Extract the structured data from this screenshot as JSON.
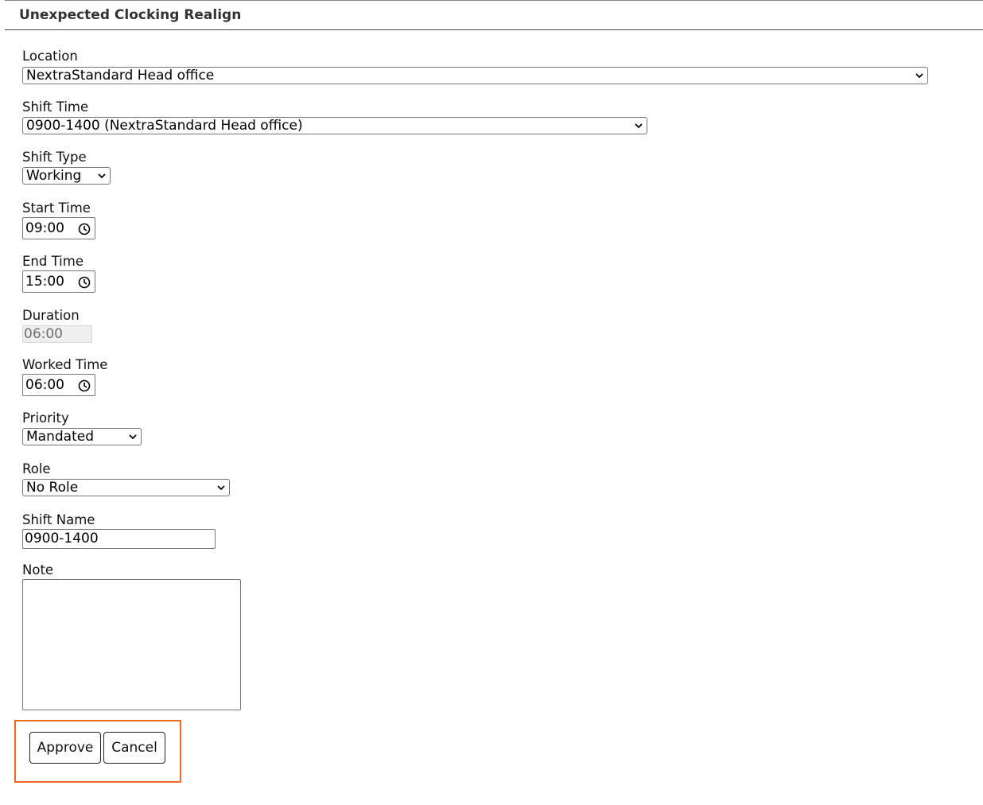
{
  "dialog": {
    "title": "Unexpected Clocking Realign"
  },
  "form": {
    "location": {
      "label": "Location",
      "value": "NextraStandard Head office"
    },
    "shift_time": {
      "label": "Shift Time",
      "value": "0900-1400 (NextraStandard Head office)"
    },
    "shift_type": {
      "label": "Shift Type",
      "value": "Working"
    },
    "start_time": {
      "label": "Start Time",
      "value": "09:00"
    },
    "end_time": {
      "label": "End Time",
      "value": "15:00"
    },
    "duration": {
      "label": "Duration",
      "value": "06:00"
    },
    "worked_time": {
      "label": "Worked Time",
      "value": "06:00"
    },
    "priority": {
      "label": "Priority",
      "value": "Mandated"
    },
    "role": {
      "label": "Role",
      "value": "No Role"
    },
    "shift_name": {
      "label": "Shift Name",
      "value": "0900-1400"
    },
    "note": {
      "label": "Note",
      "value": ""
    }
  },
  "actions": {
    "approve_label": "Approve",
    "cancel_label": "Cancel"
  },
  "colors": {
    "highlight": "#ec6c1f",
    "border": "#767676",
    "disabled_bg": "#efefef"
  }
}
